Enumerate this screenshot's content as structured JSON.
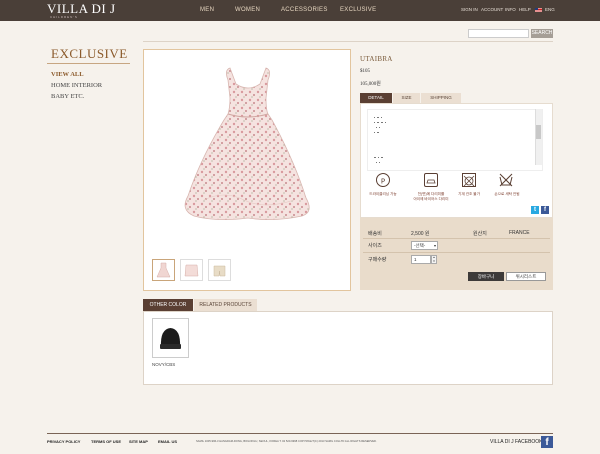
{
  "header": {
    "logo": "VILLA DI J",
    "logo_sub": "CHILDREN'S",
    "nav": [
      "MEN",
      "WOMEN",
      "ACCESSORIES",
      "EXCLUSIVE"
    ],
    "util": [
      "SIGN IN",
      "ACCOUNT",
      "INFO",
      "HELP"
    ],
    "lang": "ENG",
    "colors": {
      "bar": "#4a3f38",
      "nav_text": "#e6d6c0"
    }
  },
  "search": {
    "placeholder": "",
    "button": "SEARCH"
  },
  "sidebar": {
    "title": "EXCLUSIVE",
    "items": [
      {
        "label": "VIEW ALL",
        "active": true
      },
      {
        "label": "HOME INTERIOR",
        "active": false
      },
      {
        "label": "BABY ETC.",
        "active": false
      }
    ]
  },
  "product": {
    "name": "UTAIBRA",
    "price_usd": "$105",
    "price_krw": "105,000원",
    "tabs": [
      "DETAIL",
      "SIZE",
      "SHIPPING"
    ],
    "active_tab": "DETAIL",
    "care": [
      {
        "icon": "dry-clean-icon",
        "label": "드라이클리닝 가능"
      },
      {
        "icon": "iron-icon",
        "label": "천(면)에 다리미를\n아이에 바이어스 다리미"
      },
      {
        "icon": "no-machine-dry-icon",
        "label": "기계 건조 불가"
      },
      {
        "icon": "no-hand-wash-icon",
        "label": "손으로 세탁 안됨"
      }
    ],
    "shipping_label": "배송비",
    "shipping_value": "2,500 원",
    "origin_label": "원산지",
    "origin_value": "FRANCE",
    "size_label": "사이즈",
    "size_selected": "-선택-",
    "qty_label": "구매수량",
    "qty_value": "1",
    "cart_button": "장바구니",
    "wish_button": "위시리스트"
  },
  "related": {
    "tabs": [
      "OTHER COLOR",
      "RELATED PRODUCTS"
    ],
    "active_tab": "OTHER COLOR",
    "items": [
      {
        "label": "NOVY/CBS",
        "icon": "black-beanie-icon"
      }
    ]
  },
  "footer": {
    "links": [
      "PRIVACY POLICY",
      "TERMS OF USE",
      "SITE MAP",
      "EMAIL US"
    ],
    "address": "SAMIL 1005-996-3 HANGDAM-DONG, BOGOKGU, SEOUL, KOREA T. 02 520-9998 COPYRIGHT(C) 2013 SAMIL COLLTD ALL RIGHTS RESERVED.",
    "facebook_label": "VILLA DI J  FACEBOOK"
  }
}
